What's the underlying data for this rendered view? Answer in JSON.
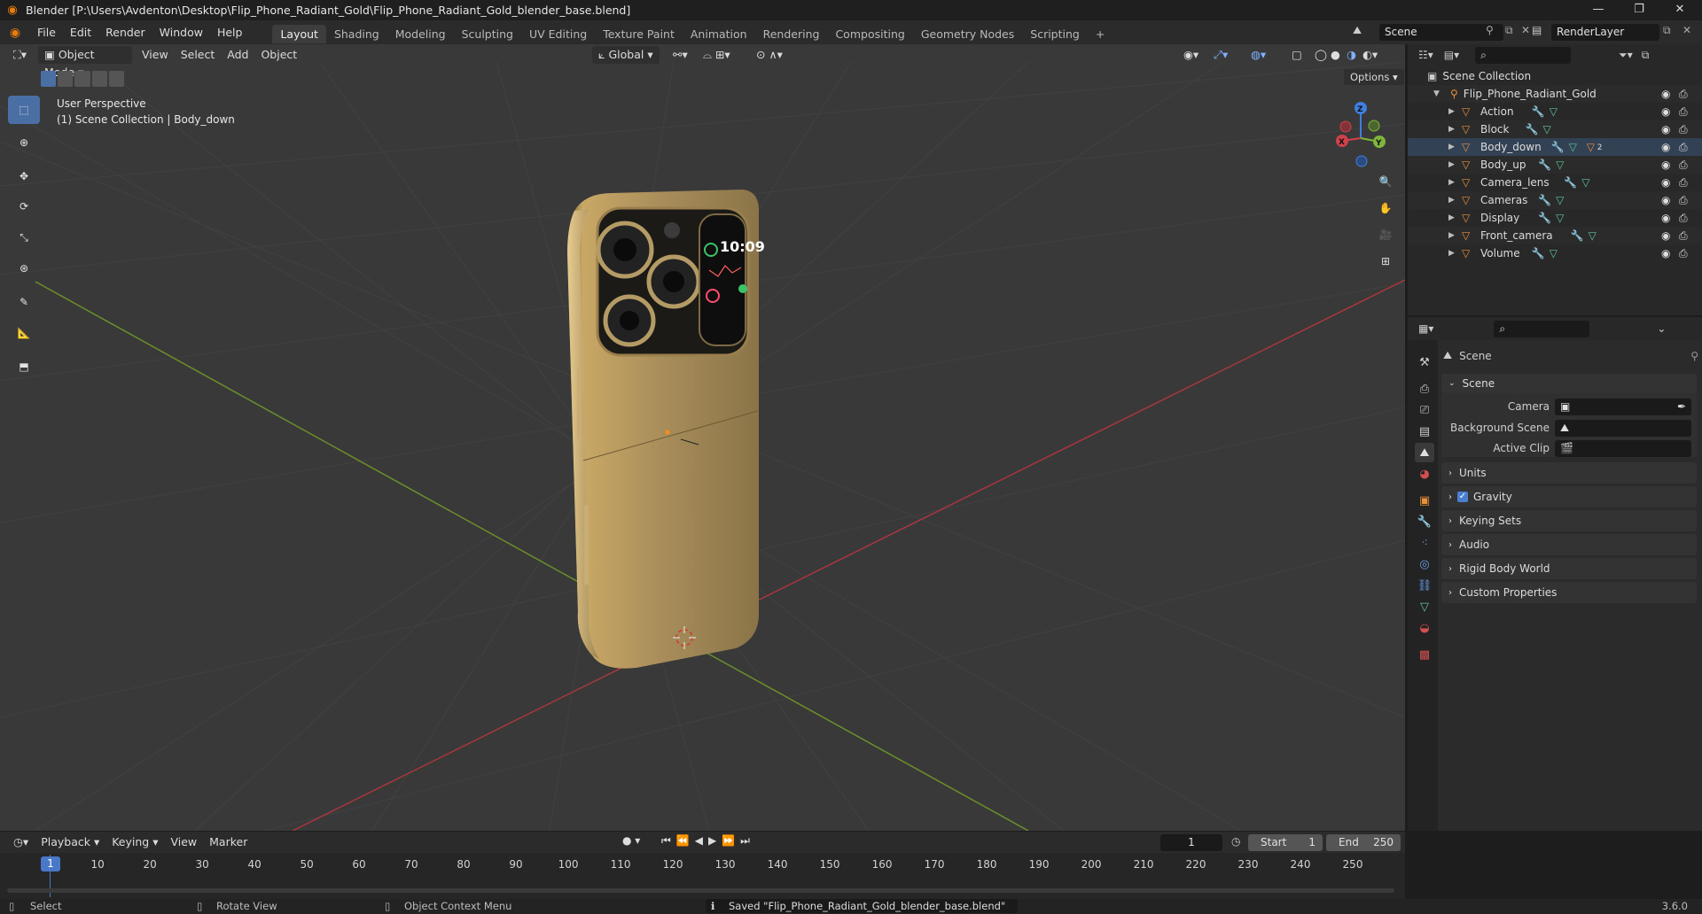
{
  "window": {
    "title": "Blender [P:\\Users\\Avdenton\\Desktop\\Flip_Phone_Radiant_Gold\\Flip_Phone_Radiant_Gold_blender_base.blend]",
    "minimize": "—",
    "maximize": "❐",
    "close": "✕"
  },
  "menu": [
    "File",
    "Edit",
    "Render",
    "Window",
    "Help"
  ],
  "workspaces": [
    "Layout",
    "Shading",
    "Modeling",
    "Sculpting",
    "UV Editing",
    "Texture Paint",
    "Animation",
    "Rendering",
    "Compositing",
    "Geometry Nodes",
    "Scripting",
    "+"
  ],
  "scene_field": "Scene",
  "view_layer_field": "RenderLayer",
  "viewport": {
    "mode": "Object Mode",
    "menus": [
      "View",
      "Select",
      "Add",
      "Object"
    ],
    "transform_orientation": "Global",
    "options": "Options",
    "overlay_title": "User Perspective",
    "overlay_subtitle": "(1) Scene Collection | Body_down",
    "phone_time": "10:09",
    "gizmo": {
      "z": "Z",
      "x": "X",
      "y": "Y"
    }
  },
  "outliner": {
    "root": "Scene Collection",
    "collection": "Flip_Phone_Radiant_Gold",
    "objects": [
      "Action",
      "Block",
      "Body_down",
      "Body_up",
      "Camera_lens",
      "Cameras",
      "Display",
      "Front_camera",
      "Volume"
    ],
    "body_down_badge": "2"
  },
  "properties": {
    "header": "Scene",
    "section": "Scene",
    "fields": [
      {
        "label": "Camera"
      },
      {
        "label": "Background Scene"
      },
      {
        "label": "Active Clip"
      }
    ],
    "panels": [
      "Units",
      "Gravity",
      "Keying Sets",
      "Audio",
      "Rigid Body World",
      "Custom Properties"
    ]
  },
  "timeline": {
    "menus": [
      "Playback",
      "Keying",
      "View",
      "Marker"
    ],
    "current_frame": "1",
    "start_label": "Start",
    "start": "1",
    "end_label": "End",
    "end": "250",
    "ruler": [
      "1",
      "10",
      "20",
      "30",
      "40",
      "50",
      "60",
      "70",
      "80",
      "90",
      "100",
      "110",
      "120",
      "130",
      "140",
      "150",
      "160",
      "170",
      "180",
      "190",
      "200",
      "210",
      "220",
      "230",
      "240",
      "250"
    ]
  },
  "status": {
    "select": "Select",
    "rotate": "Rotate View",
    "context_menu": "Object Context Menu",
    "message": "Saved \"Flip_Phone_Radiant_Gold_blender_base.blend\"",
    "version": "3.6.0"
  },
  "colors": {
    "accent": "#4a6fa5",
    "object_orange": "#e8903a",
    "mesh_green": "#5fc59b",
    "modifier_blue": "#6a9ee8"
  }
}
